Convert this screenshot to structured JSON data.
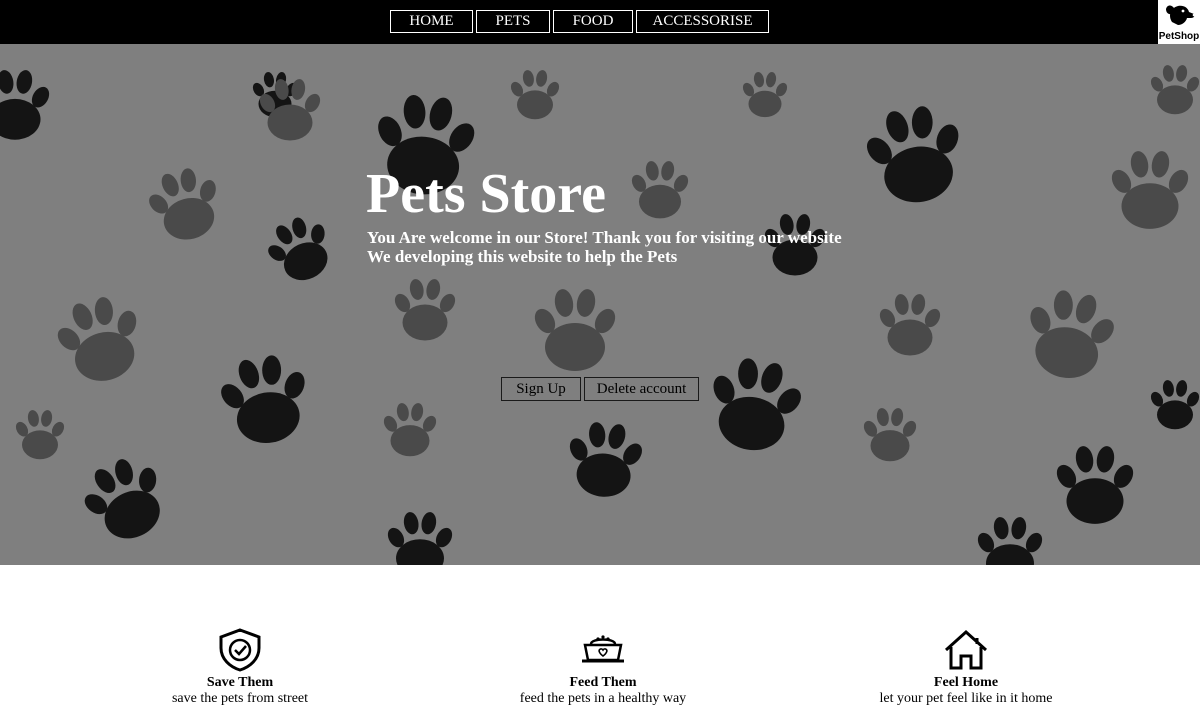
{
  "nav": {
    "items": [
      {
        "label": "HOME"
      },
      {
        "label": "PETS"
      },
      {
        "label": "FOOD"
      },
      {
        "label": "ACCESSORISE"
      }
    ],
    "logo_text": "PetShop"
  },
  "hero": {
    "title": "Pets Store",
    "lines": [
      "You Are welcome in our Store! Thank you for visiting our website",
      "We developing this website to help the Pets"
    ],
    "buttons": [
      {
        "label": "Sign Up"
      },
      {
        "label": "Delete account"
      }
    ]
  },
  "features": [
    {
      "icon": "shield-check-icon",
      "title": "Save Them",
      "desc": "save the pets from street"
    },
    {
      "icon": "pet-food-bowl-icon",
      "title": "Feed Them",
      "desc": "feed the pets in a healthy way"
    },
    {
      "icon": "house-icon",
      "title": "Feel Home",
      "desc": "let your pet feel like in it home"
    }
  ],
  "colors": {
    "nav_background": "#000000",
    "hero_background": "#7f7f7f",
    "paw_dark": "#141414",
    "paw_hatched": "#4a4a4a",
    "text_light": "#ffffff"
  }
}
